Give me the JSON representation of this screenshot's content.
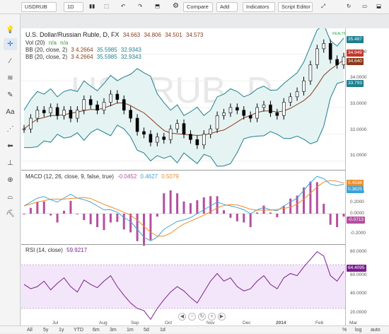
{
  "toolbar": {
    "symbol": "USDRUB",
    "interval": "1D",
    "compare": "Compare",
    "add": "Add",
    "indicators": "Indicators",
    "script_editor": "Script Editor"
  },
  "legends": {
    "title": "U.S. Dollar/Russian Ruble, D, FX",
    "ohlc": [
      "34.663",
      "34.806",
      "34.501",
      "34.573"
    ],
    "vol": "Vol (20)",
    "vol_vals": [
      "n/a",
      "n/a"
    ],
    "bb1": "BB (20, close, 2)",
    "bb1_vals": [
      "3 4.2664",
      "35.5985",
      "32.9343"
    ],
    "bb2": "BB (20, close, 2)",
    "bb2_vals": [
      "3 4.2664",
      "35.5985",
      "32.9343"
    ],
    "macd": "MACD (12, 26, close, 9, false, true)",
    "macd_vals": [
      "-0.0452",
      "0.4627",
      "0.5079"
    ],
    "rsi": "RSI (14, close)",
    "rsi_val": "59.9217",
    "realtime": "REALTIME"
  },
  "watermark": {
    "symbol": "USDRUB, D",
    "name": "U.S. Dollar/Russian Ruble"
  },
  "price_axis": [
    "35.0000",
    "34.0000",
    "33.0000",
    "32.0000",
    "31.0000"
  ],
  "price_badges": {
    "upper": "35.487",
    "last": "34.949",
    "bb": "34.640",
    "lower": "33.793"
  },
  "macd_axis": [
    "0.4000",
    "0.2000",
    "0.0000",
    "-0.2000"
  ],
  "macd_badges": {
    "signal": "0.4538",
    "macd": "0.3825",
    "hist": "-0.0713"
  },
  "rsi_axis": [
    "80.0000",
    "60.0000",
    "40.0000",
    "20.0000"
  ],
  "rsi_badge": "64.4095",
  "x_labels": [
    "Jul",
    "Aug",
    "Sep",
    "Oct",
    "Nov",
    "Dec",
    "2014",
    "Feb",
    "Mar"
  ],
  "ranges": [
    "All",
    "5y",
    "1y",
    "YTD",
    "6m",
    "3m",
    "1m",
    "5d",
    "1d"
  ],
  "bottom_right": [
    "%",
    "log",
    "auto"
  ],
  "colors": {
    "up": "#000000",
    "down": "#000000",
    "bb": "#1e7f8f",
    "ma": "#8b3a1a",
    "macd": "#3ba3d8",
    "signal": "#f08a24",
    "hist_pos": "#b44fa0",
    "rsi": "#7a1f8e",
    "rsi_band": "#f3e6fa"
  },
  "chart_data": {
    "type": "line",
    "series": [
      {
        "name": "Close",
        "values": [
          32.2,
          32.6,
          32.9,
          32.8,
          33.0,
          32.7,
          32.9,
          32.6,
          32.9,
          33.3,
          33.1,
          32.9,
          33.2,
          33.5,
          33.3,
          32.9,
          32.6,
          32.1,
          32.0,
          31.7,
          31.9,
          31.8,
          32.2,
          32.4,
          32.0,
          31.8,
          31.6,
          32.0,
          32.2,
          32.7,
          32.8,
          33.0,
          32.9,
          32.7,
          32.6,
          33.0,
          33.1,
          32.8,
          32.7,
          33.2,
          33.4,
          33.6,
          34.0,
          34.6,
          35.2,
          35.4,
          34.8,
          34.6,
          34.9
        ]
      },
      {
        "name": "RSI",
        "values": [
          52,
          48,
          50,
          55,
          47,
          53,
          58,
          50,
          45,
          56,
          52,
          49,
          55,
          60,
          50,
          42,
          35,
          30,
          28,
          20,
          30,
          38,
          45,
          50,
          46,
          40,
          35,
          45,
          55,
          62,
          55,
          58,
          50,
          46,
          48,
          55,
          60,
          52,
          48,
          58,
          62,
          60,
          68,
          75,
          82,
          78,
          60,
          55,
          64
        ]
      },
      {
        "name": "MACD",
        "values": [
          0.1,
          0.15,
          0.2,
          0.22,
          0.18,
          0.15,
          0.2,
          0.25,
          0.2,
          0.18,
          0.15,
          0.1,
          0.05,
          0.05,
          0.02,
          -0.05,
          -0.1,
          -0.2,
          -0.3,
          -0.35,
          -0.3,
          -0.2,
          -0.15,
          -0.1,
          -0.08,
          -0.05,
          0.0,
          0.05,
          0.1,
          0.15,
          0.12,
          0.1,
          0.08,
          0.05,
          0.0,
          0.05,
          0.08,
          0.05,
          0.04,
          0.1,
          0.15,
          0.2,
          0.3,
          0.4,
          0.48,
          0.45,
          0.38,
          0.36,
          0.38
        ]
      }
    ]
  }
}
